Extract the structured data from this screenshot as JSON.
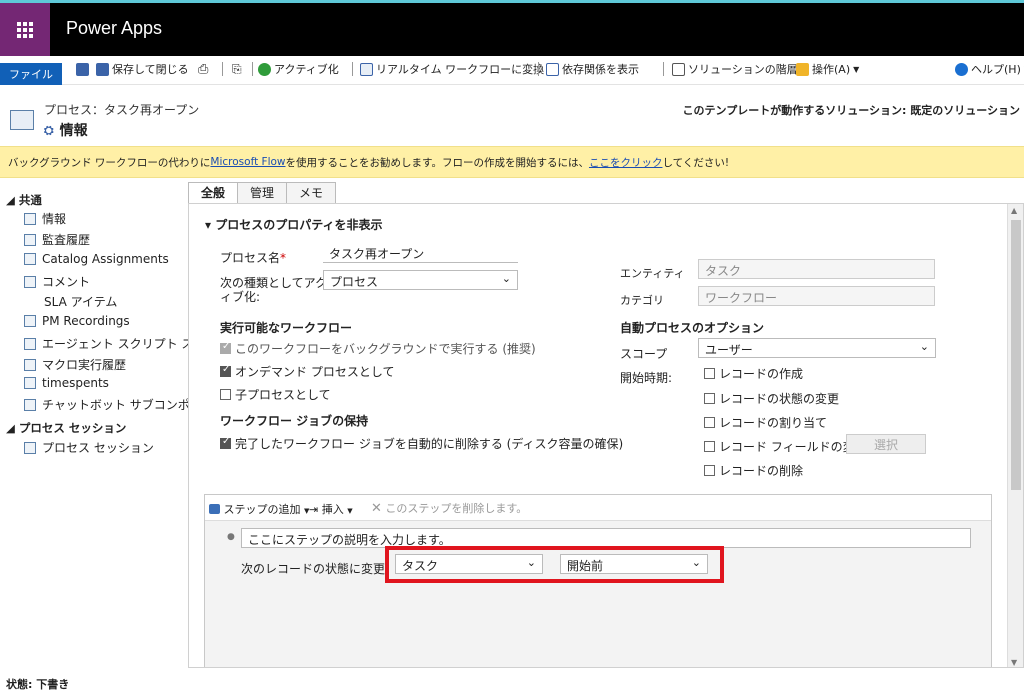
{
  "app": {
    "name": "Power Apps"
  },
  "ribbon": {
    "file_tab": "ファイル",
    "save_close": "保存して閉じる",
    "activate": "アクティブ化",
    "convert": "リアルタイム ワークフローに変換",
    "dependencies": "依存関係を表示",
    "layers": "ソリューションの階層",
    "actions": "操作(A)",
    "help": "ヘルプ(H)"
  },
  "header": {
    "breadcrumb": "プロセス：タスク再オープン",
    "title": "情報",
    "solution": "このテンプレートが動作するソリューション: 既定のソリューション"
  },
  "banner": {
    "text_before": "バックグラウンド ワークフローの代わりに ",
    "link1": "Microsoft Flow",
    "text_middle": " を使用することをお勧めします。フローの作成を開始するには、",
    "link2": "ここをクリック",
    "text_after": " してください!"
  },
  "nav": {
    "group_common": "共通",
    "items": [
      "情報",
      "監査履歴",
      "Catalog Assignments",
      "コメント",
      "SLA アイテム",
      "PM Recordings",
      "エージェント スクリプト ス…",
      "マクロ実行履歴",
      "timespents",
      "チャットボット サブコンポ…"
    ],
    "group_session": "プロセス セッション",
    "session_item": "プロセス セッション"
  },
  "tabs": [
    "全般",
    "管理",
    "メモ"
  ],
  "section": {
    "title": "プロセスのプロパティを非表示"
  },
  "form": {
    "process_name_label": "プロセス名",
    "required_mark": "*",
    "process_name_value": "タスク再オープン",
    "activate_as_label_1": "次の種類としてアクテ",
    "activate_as_label_2": "ィブ化:",
    "activate_as_value": "プロセス",
    "entity_label": "エンティティ",
    "entity_value": "タスク",
    "category_label": "カテゴリ",
    "category_value": "ワークフロー",
    "available_heading": "実行可能なワークフロー",
    "run_background": "このワークフローをバックグラウンドで実行する (推奨)",
    "on_demand": "オンデマンド プロセスとして",
    "child_process": "子プロセスとして",
    "retention_heading": "ワークフロー ジョブの保持",
    "auto_delete": "完了したワークフロー ジョブを自動的に削除する (ディスク容量の確保)",
    "auto_options_heading": "自動プロセスのオプション",
    "scope_label": "スコープ",
    "scope_value": "ユーザー",
    "start_when_label": "開始時期:",
    "start_options": [
      "レコードの作成",
      "レコードの状態の変更",
      "レコードの割り当て",
      "レコード フィールドの変更",
      "レコードの削除"
    ],
    "select_button": "選択"
  },
  "steps": {
    "add_step": "ステップの追加",
    "insert": "挿入",
    "delete_step": "このステップを削除します。",
    "description": "ここにステップの説明を入力します。",
    "change_status_label": "次のレコードの状態に変更:",
    "entity_select": "タスク",
    "status_select": "開始前"
  },
  "status": {
    "text": "状態: 下書き"
  }
}
